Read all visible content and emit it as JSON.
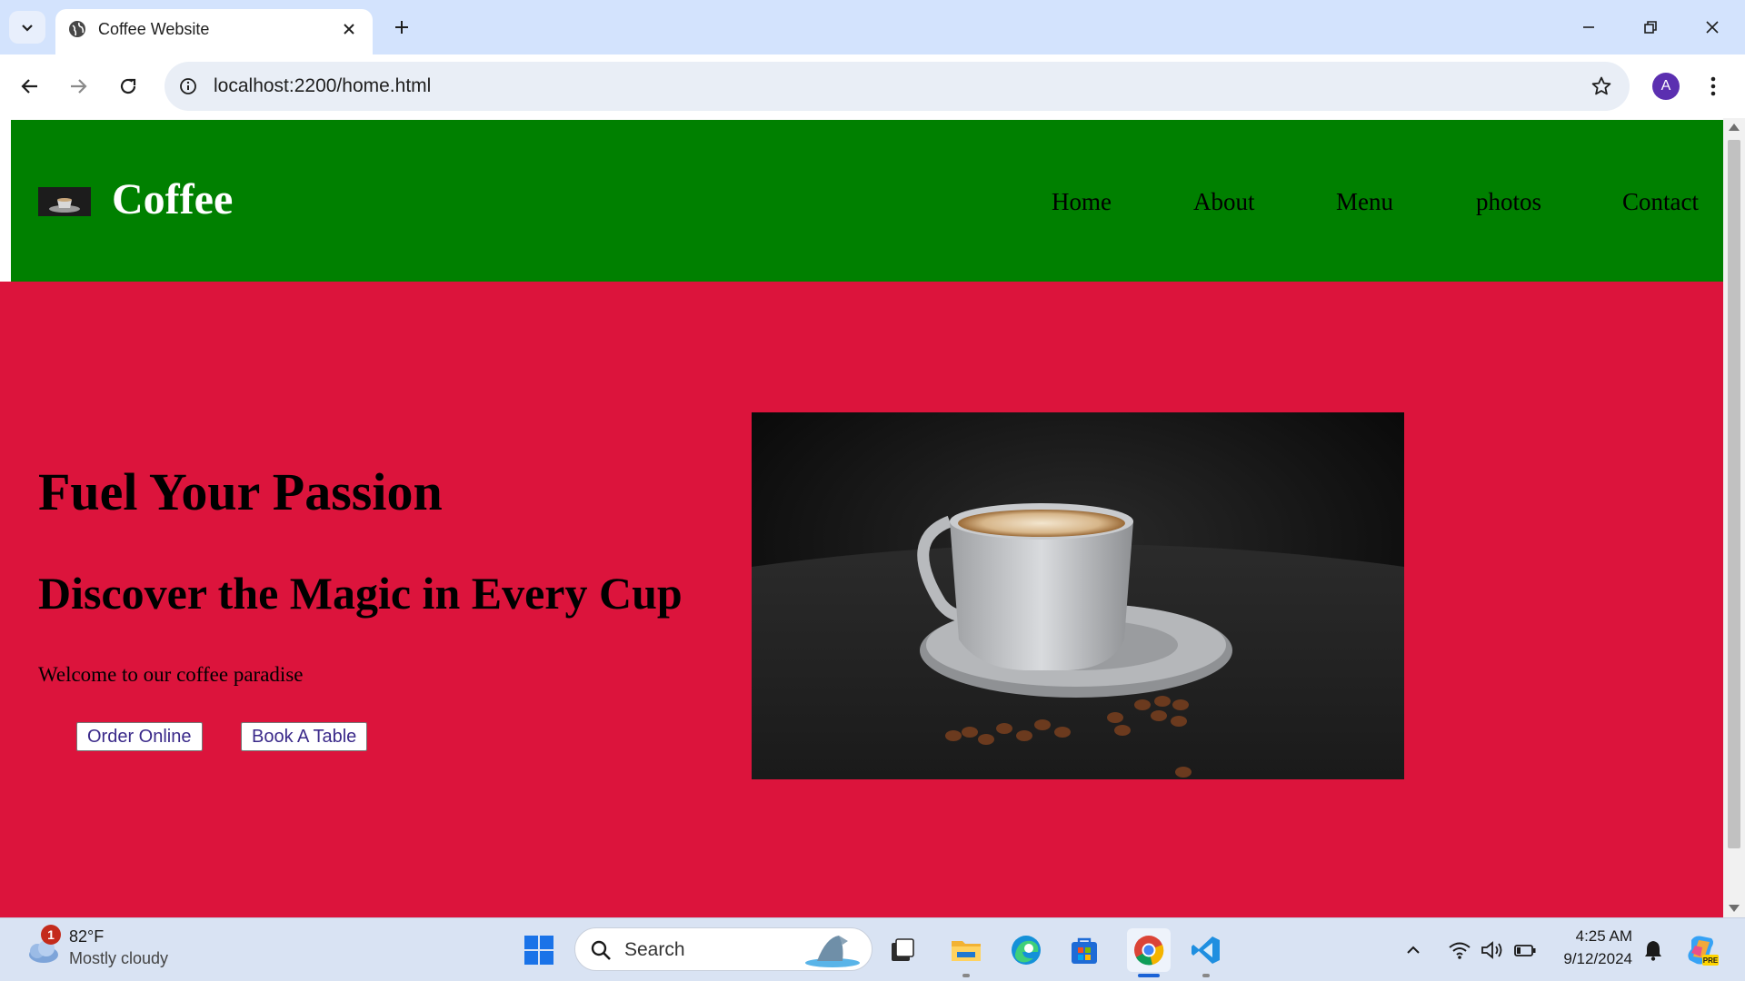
{
  "browser": {
    "tab_title": "Coffee Website",
    "url": "localhost:2200/home.html",
    "profile_initial": "A"
  },
  "site": {
    "logo_text": "Coffee",
    "nav": [
      {
        "label": "Home"
      },
      {
        "label": "About"
      },
      {
        "label": "Menu"
      },
      {
        "label": "photos"
      },
      {
        "label": "Contact"
      }
    ],
    "hero": {
      "title": "Fuel Your Passion",
      "subtitle": "Discover the Magic in Every Cup",
      "text": "Welcome to our coffee paradise",
      "buttons": [
        {
          "label": "Order Online"
        },
        {
          "label": "Book A Table"
        }
      ]
    },
    "colors": {
      "header_bg": "#008000",
      "hero_bg": "#dc143c"
    }
  },
  "taskbar": {
    "weather": {
      "badge": "1",
      "temp": "82°F",
      "desc": "Mostly cloudy"
    },
    "search_label": "Search",
    "time": "4:25 AM",
    "date": "9/12/2024"
  }
}
